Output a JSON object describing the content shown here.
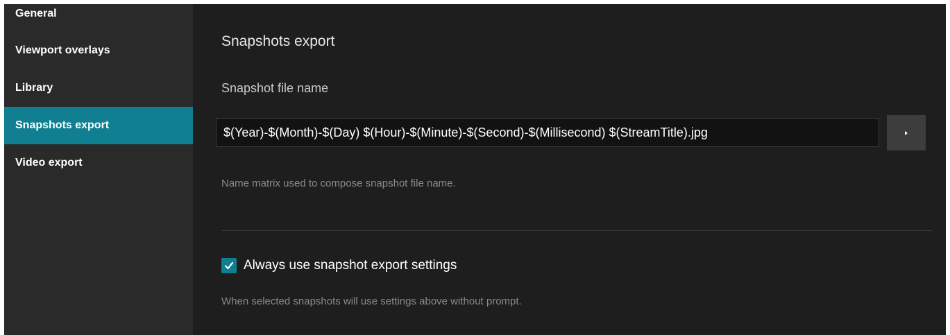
{
  "sidebar": {
    "items": [
      {
        "label": "General",
        "active": false
      },
      {
        "label": "Viewport overlays",
        "active": false
      },
      {
        "label": "Library",
        "active": false
      },
      {
        "label": "Snapshots export",
        "active": true
      },
      {
        "label": "Video export",
        "active": false
      }
    ]
  },
  "main": {
    "section_title": "Snapshots export",
    "filename": {
      "label": "Snapshot file name",
      "value": "$(Year)-$(Month)-$(Day) $(Hour)-$(Minute)-$(Second)-$(Millisecond) $(StreamTitle).jpg",
      "help": "Name matrix used to compose snapshot file name.",
      "expand_icon": "triangle-right-icon"
    },
    "always_use": {
      "checked": true,
      "label": "Always use snapshot export settings",
      "help": "When selected snapshots will use settings above without prompt.",
      "icon": "checkmark-icon"
    }
  },
  "colors": {
    "accent": "#0f7f91",
    "background": "#1e1e1e",
    "sidebar": "#2a2a2a"
  }
}
